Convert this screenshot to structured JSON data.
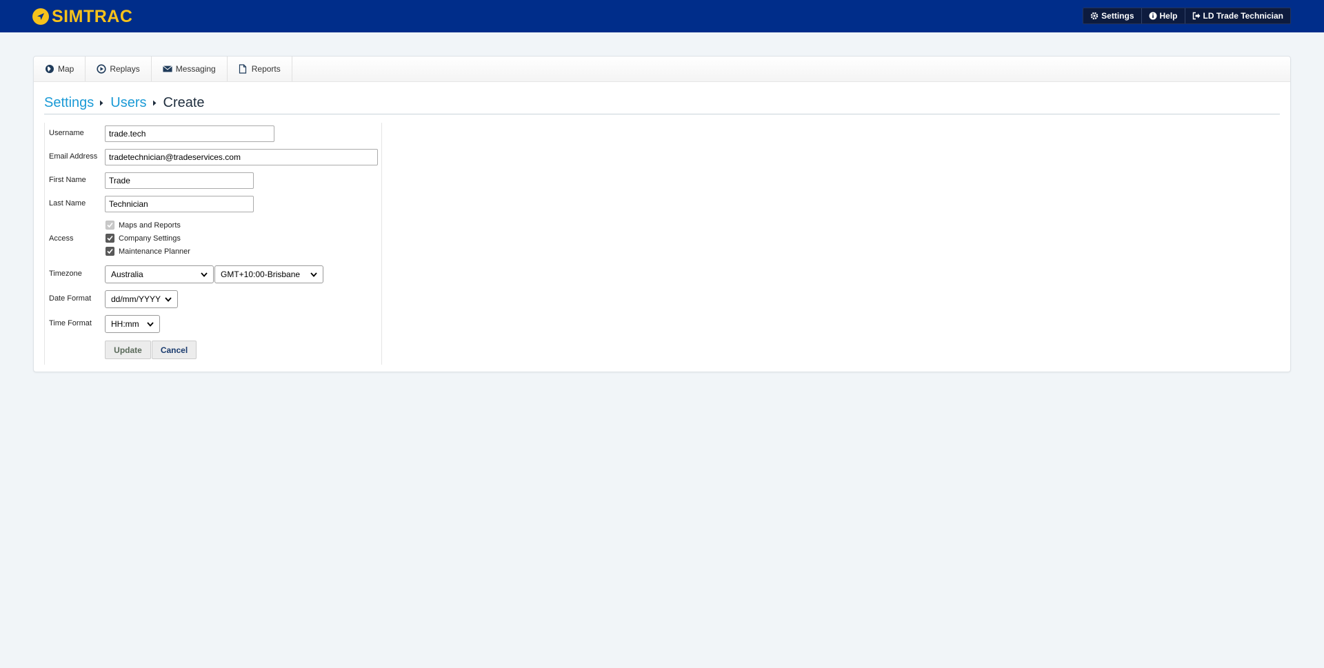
{
  "app": {
    "brand": "SIMTRAC",
    "brand_color": "#f7c21b",
    "header_color": "#002d8a"
  },
  "topnav": {
    "settings": "Settings",
    "help": "Help",
    "user": "LD Trade Technician"
  },
  "tabs": [
    {
      "label": "Map",
      "icon": "globe-icon"
    },
    {
      "label": "Replays",
      "icon": "play-circle-icon"
    },
    {
      "label": "Messaging",
      "icon": "envelope-icon"
    },
    {
      "label": "Reports",
      "icon": "document-icon"
    }
  ],
  "breadcrumb": {
    "settings": "Settings",
    "users": "Users",
    "current": "Create"
  },
  "form": {
    "username": {
      "label": "Username",
      "value": "trade.tech"
    },
    "email": {
      "label": "Email Address",
      "value": "tradetechnician@tradeservices.com"
    },
    "first_name": {
      "label": "First Name",
      "value": "Trade"
    },
    "last_name": {
      "label": "Last Name",
      "value": "Technician"
    },
    "access": {
      "label": "Access",
      "options": [
        {
          "label": "Maps and Reports",
          "checked": true,
          "disabled": true
        },
        {
          "label": "Company Settings",
          "checked": true,
          "disabled": false
        },
        {
          "label": "Maintenance Planner",
          "checked": true,
          "disabled": false
        }
      ]
    },
    "timezone": {
      "label": "Timezone",
      "region": "Australia",
      "zone": "GMT+10:00-Brisbane"
    },
    "date_format": {
      "label": "Date Format",
      "value": "dd/mm/YYYY"
    },
    "time_format": {
      "label": "Time Format",
      "value": "HH:mm"
    },
    "update_label": "Update",
    "cancel_label": "Cancel"
  }
}
